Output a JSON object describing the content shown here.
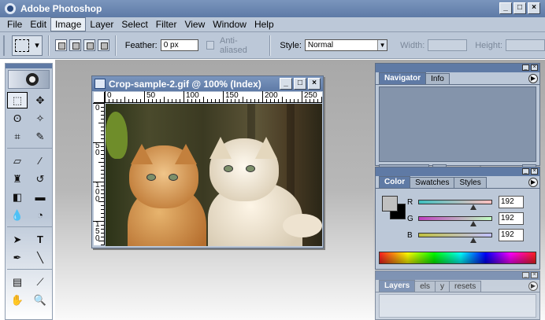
{
  "window": {
    "title": "Adobe Photoshop",
    "buttons": [
      "_",
      "□",
      "×"
    ]
  },
  "menu": [
    "File",
    "Edit",
    "Image",
    "Layer",
    "Select",
    "Filter",
    "View",
    "Window",
    "Help"
  ],
  "menu_active": "Image",
  "options": {
    "feather_label": "Feather:",
    "feather_value": "0 px",
    "antialiased_label": "Anti-aliased",
    "style_label": "Style:",
    "style_value": "Normal",
    "width_label": "Width:",
    "height_label": "Height:"
  },
  "document": {
    "title": "Crop-sample-2.gif @ 100% (Index)",
    "h_ruler_labels": [
      "0",
      "50",
      "100",
      "150",
      "200",
      "250"
    ],
    "v_ruler_labels": [
      "0",
      "50",
      "100",
      "150"
    ]
  },
  "navigator_panel": {
    "tabs": [
      "Navigator",
      "Info"
    ],
    "active_tab": "Navigator",
    "zoom_out_icon": "small-mountains-icon",
    "zoom_in_icon": "large-mountains-icon"
  },
  "color_panel": {
    "tabs": [
      "Color",
      "Swatches",
      "Styles"
    ],
    "active_tab": "Color",
    "foreground_color": "#c0c0c0",
    "background_color": "#000000",
    "r_label": "R",
    "g_label": "G",
    "b_label": "B",
    "r_value": "192",
    "g_value": "192",
    "b_value": "192"
  },
  "layers_panel": {
    "tabs": [
      "Layers",
      "els",
      "y",
      "resets"
    ],
    "active_tab": "Layers"
  },
  "colors": {
    "titlebar": "#5e7aa6",
    "chrome": "#bcc8d8"
  }
}
